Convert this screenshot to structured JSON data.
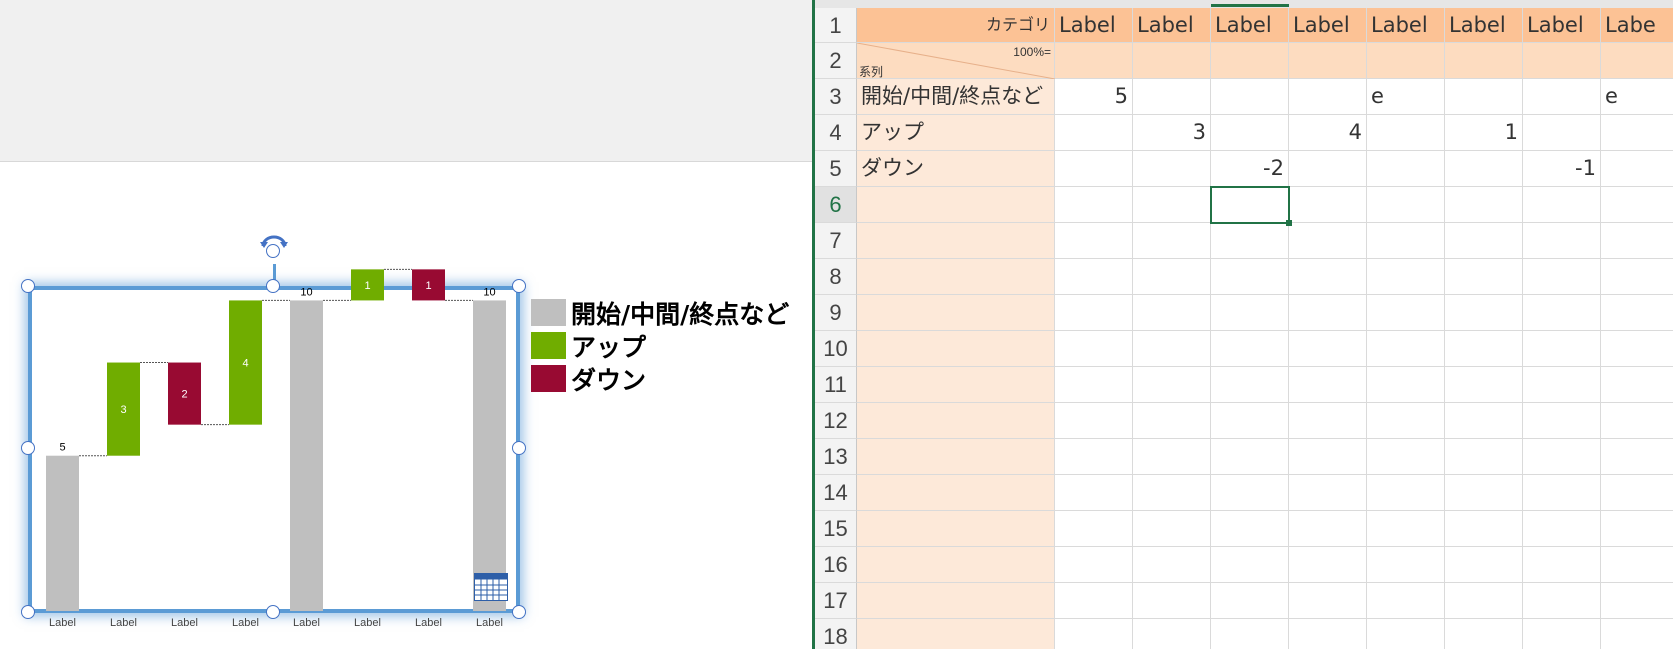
{
  "chart_data": {
    "type": "bar",
    "subtype": "waterfall",
    "categories": [
      "Label",
      "Label",
      "Label",
      "Label",
      "Label",
      "Label",
      "Label",
      "Label"
    ],
    "series": [
      {
        "name": "開始/中間/終点など",
        "color": "#bfbfbf",
        "values": [
          5,
          null,
          null,
          null,
          10,
          null,
          null,
          10
        ]
      },
      {
        "name": "アップ",
        "color": "#70ad00",
        "values": [
          null,
          3,
          null,
          4,
          null,
          1,
          null,
          null
        ]
      },
      {
        "name": "ダウン",
        "color": "#980a32",
        "values": [
          null,
          null,
          -2,
          null,
          null,
          null,
          -1,
          null
        ]
      }
    ],
    "bar_labels": [
      "5",
      "3",
      "2",
      "4",
      "10",
      "1",
      "1",
      "10"
    ],
    "ylim": [
      0,
      10
    ],
    "grid": false,
    "legend_position": "right"
  },
  "legend": [
    {
      "label": "開始/中間/終点など",
      "color": "#bfbfbf"
    },
    {
      "label": "アップ",
      "color": "#70ad00"
    },
    {
      "label": "ダウン",
      "color": "#980a32"
    }
  ],
  "sheet": {
    "header_corner": "カテゴリ",
    "row2_corner_top": "100%=",
    "row2_corner_bottom": "系列",
    "column_labels": [
      "Label",
      "Label",
      "Label",
      "Label",
      "Label",
      "Label",
      "Label",
      "Labe"
    ],
    "row_numbers": [
      "1",
      "2",
      "3",
      "4",
      "5",
      "6",
      "7",
      "8",
      "9",
      "10",
      "11",
      "12",
      "13",
      "14",
      "15",
      "16",
      "17",
      "18"
    ],
    "rows": [
      {
        "name": "開始/中間/終点など",
        "cells": [
          "5",
          "",
          "",
          "",
          "e",
          "",
          "",
          "e"
        ]
      },
      {
        "name": "アップ",
        "cells": [
          "",
          "3",
          "",
          "4",
          "",
          "1",
          "",
          ""
        ]
      },
      {
        "name": "ダウン",
        "cells": [
          "",
          "",
          "-2",
          "",
          "",
          "",
          "-1",
          ""
        ]
      }
    ]
  }
}
